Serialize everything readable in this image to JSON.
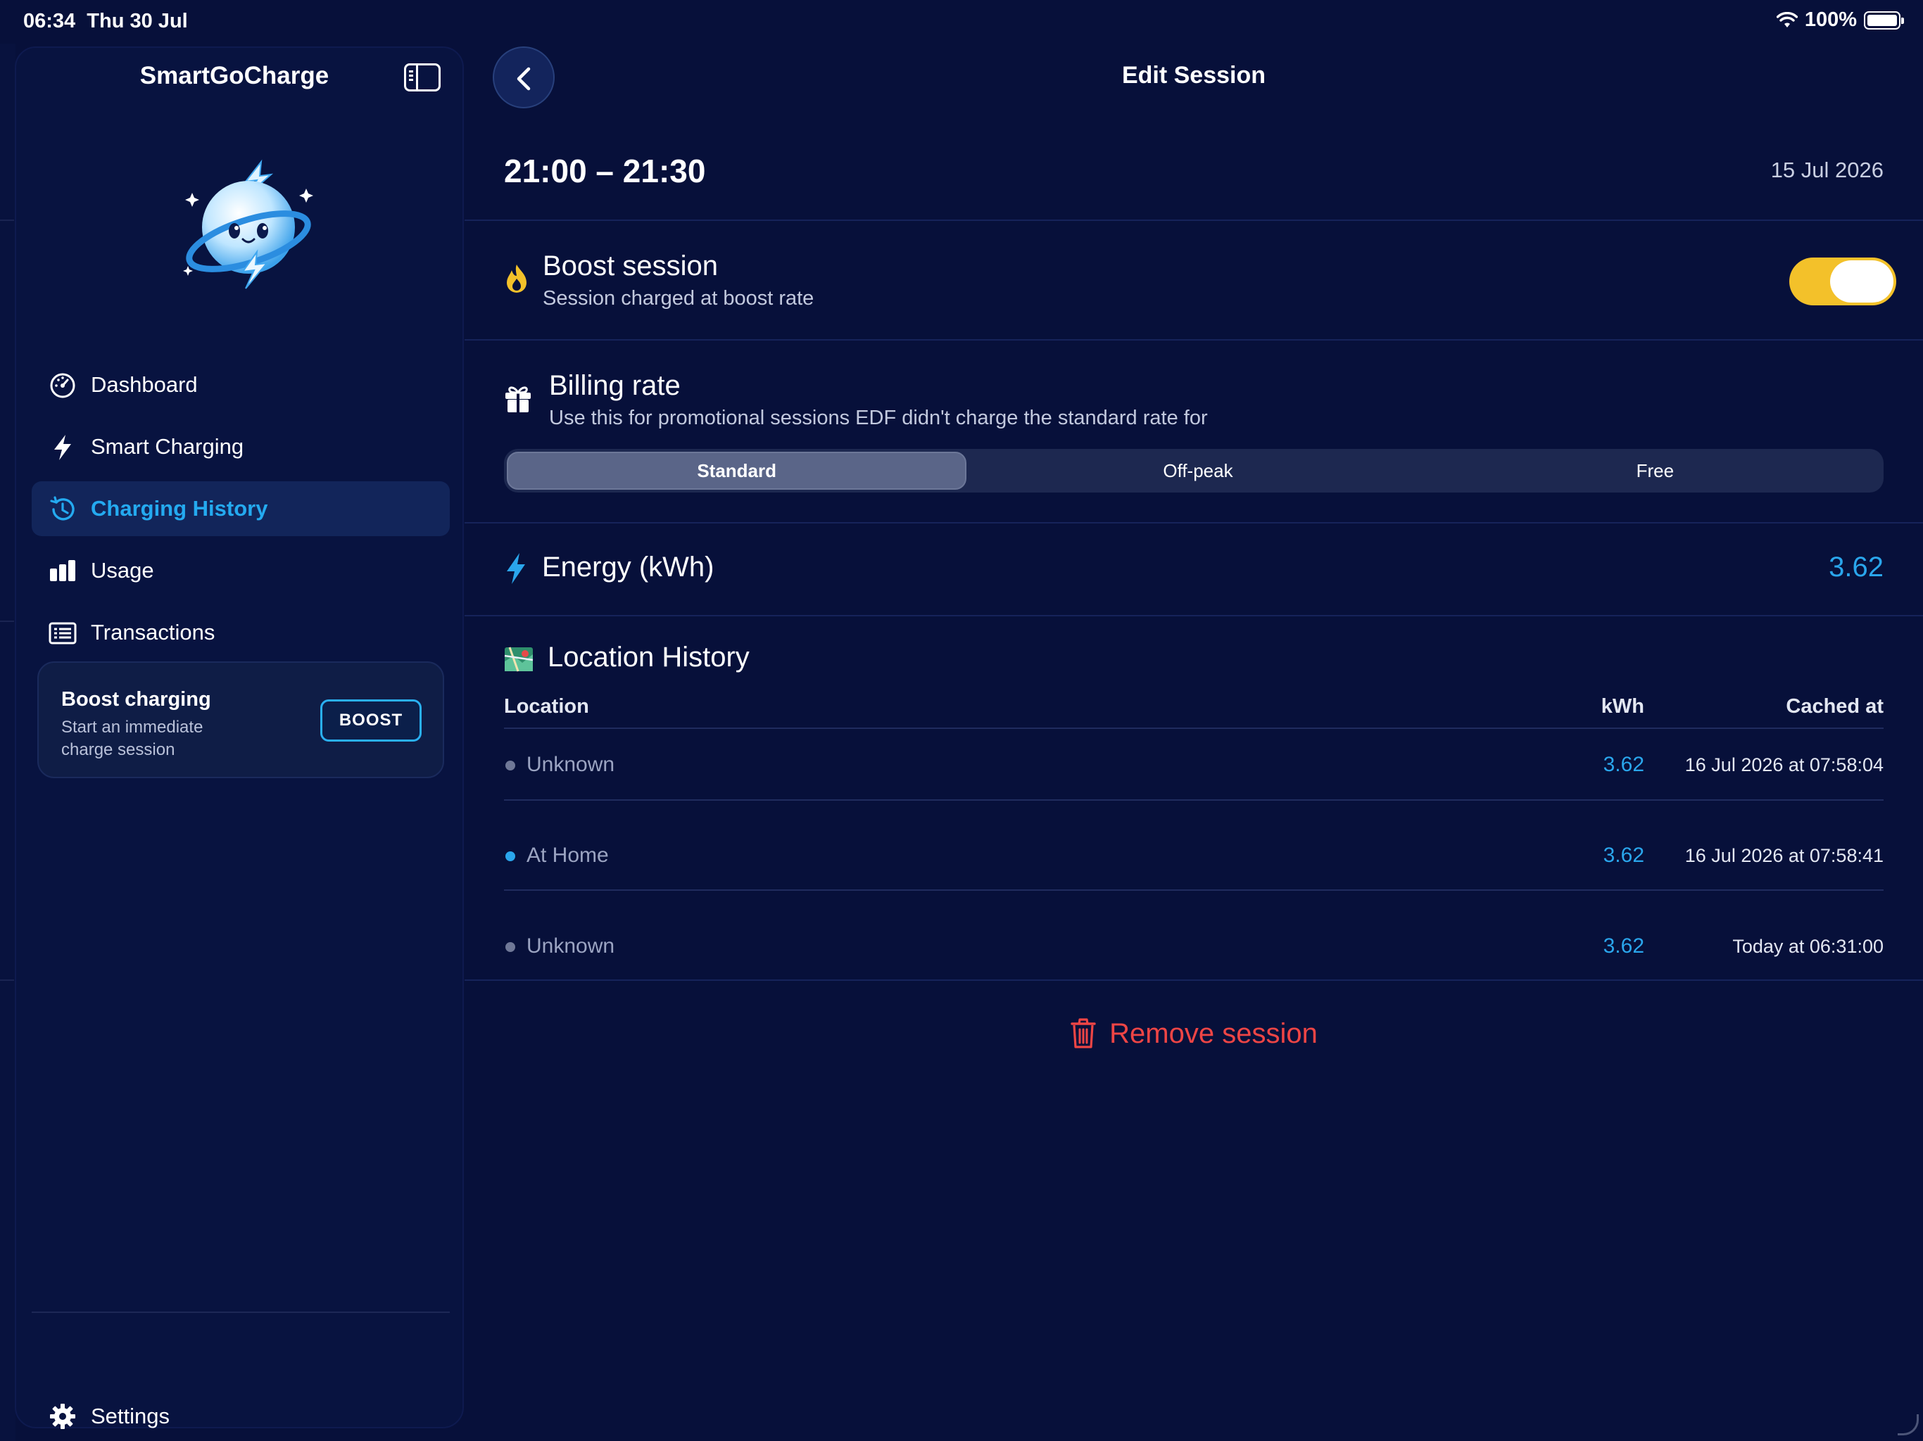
{
  "status_bar": {
    "time": "06:34",
    "date": "Thu 30 Jul",
    "battery": "100%",
    "icons": [
      "wifi-icon",
      "battery-icon"
    ]
  },
  "sidebar": {
    "app_title": "SmartGoCharge",
    "nav_items": [
      {
        "label": "Dashboard",
        "icon": "dashboard-gauge-icon",
        "active": false
      },
      {
        "label": "Smart Charging",
        "icon": "lightning-icon",
        "active": false
      },
      {
        "label": "Charging History",
        "icon": "history-clock-icon",
        "active": true
      },
      {
        "label": "Usage",
        "icon": "bar-chart-icon",
        "active": false
      },
      {
        "label": "Transactions",
        "icon": "list-icon",
        "active": false
      }
    ],
    "boost_card": {
      "title": "Boost charging",
      "subtitle": "Start an immediate charge session",
      "button_label": "BOOST"
    },
    "settings_label": "Settings"
  },
  "main": {
    "title": "Edit Session",
    "time_range": "21:00 – 21:30",
    "date": "15 Jul 2026",
    "boost_session": {
      "title": "Boost session",
      "subtitle": "Session charged at boost rate",
      "enabled": true
    },
    "billing_rate": {
      "title": "Billing rate",
      "subtitle": "Use this for promotional sessions EDF didn't charge the standard rate for",
      "options": [
        "Standard",
        "Off-peak",
        "Free"
      ],
      "selected": "Standard"
    },
    "energy": {
      "label": "Energy (kWh)",
      "value": "3.62"
    },
    "location_history": {
      "title": "Location History",
      "columns": [
        "Location",
        "kWh",
        "Cached at"
      ],
      "rows": [
        {
          "location": "Unknown",
          "kwh": "3.62",
          "cached_at": "16 Jul 2026 at 07:58:04",
          "dot_color": "#6f7897"
        },
        {
          "location": "At Home",
          "kwh": "3.62",
          "cached_at": "16 Jul 2026 at 07:58:41",
          "dot_color": "#2aa6ec"
        },
        {
          "location": "Unknown",
          "kwh": "3.62",
          "cached_at": "Today at 06:31:00",
          "dot_color": "#6f7897"
        }
      ]
    },
    "remove_label": "Remove session"
  },
  "colors": {
    "background": "#07103a",
    "accent": "#2aa6ec",
    "toggle_on": "#f3c12a",
    "danger": "#ee4545"
  }
}
